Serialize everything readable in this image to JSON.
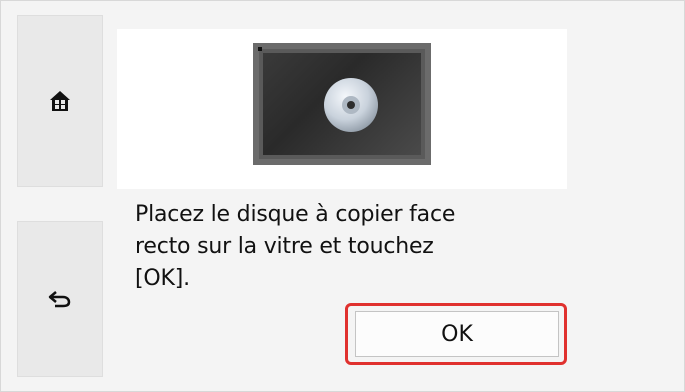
{
  "side": {
    "home_icon": "home-icon",
    "back_icon": "back-arrow-icon"
  },
  "illustration": {
    "icon": "disc-on-glass-icon"
  },
  "message": "Placez le disque à copier face\nrecto sur la vitre et touchez\n[OK].",
  "ok_button": {
    "label": "OK",
    "highlight_color": "#e0312e"
  }
}
